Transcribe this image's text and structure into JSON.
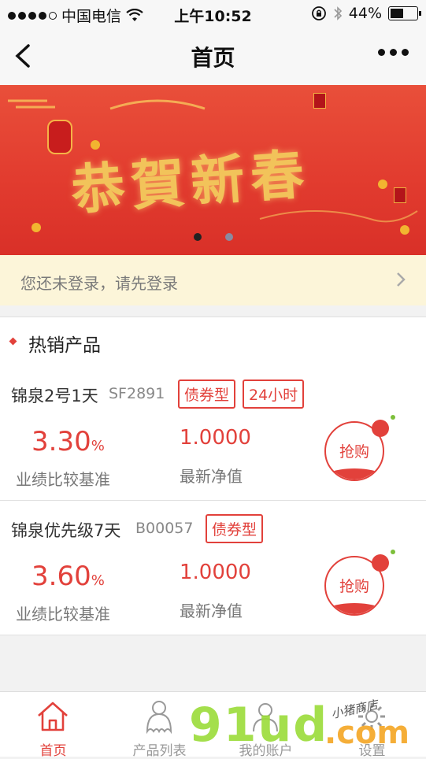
{
  "status_bar": {
    "carrier": "中国电信",
    "time": "上午10:52",
    "battery": "44%",
    "battery_level": 0.44
  },
  "nav": {
    "title": "首页",
    "back_icon": "chevron-left-icon",
    "more_icon": "more-dots-icon"
  },
  "banner": {
    "greeting": "恭賀新春",
    "active_slide": 1,
    "slide_count": 2
  },
  "login_prompt": {
    "text": "您还未登录，请先登录"
  },
  "hot_section": {
    "title": "热销产品"
  },
  "products": [
    {
      "name": "锦泉2号1天",
      "code": "SF2891",
      "tags": [
        "债券型",
        "24小时"
      ],
      "rate": "3.30",
      "rate_unit": "%",
      "rate_label": "业绩比较基准",
      "nav": "1.0000",
      "nav_label": "最新净值",
      "buy_label": "抢购"
    },
    {
      "name": "锦泉优先级7天",
      "code": "B00057",
      "tags": [
        "债券型"
      ],
      "rate": "3.60",
      "rate_unit": "%",
      "rate_label": "业绩比较基准",
      "nav": "1.0000",
      "nav_label": "最新净值",
      "buy_label": "抢购"
    }
  ],
  "tabbar": {
    "tabs": [
      {
        "label": "首页",
        "icon": "home-icon",
        "active": true
      },
      {
        "label": "产品列表",
        "icon": "product-list-icon",
        "active": false
      },
      {
        "label": "我的账户",
        "icon": "account-icon",
        "active": false
      },
      {
        "label": "设置",
        "icon": "settings-gear-icon",
        "active": false
      }
    ]
  },
  "watermark": {
    "main": "91ud",
    "suffix": ".com",
    "small": "小猪商店"
  },
  "colors": {
    "accent": "#e2413b",
    "login_bg": "#fcf5d9",
    "banner_red": "#e23c2f",
    "gold": "#f2c35a"
  }
}
